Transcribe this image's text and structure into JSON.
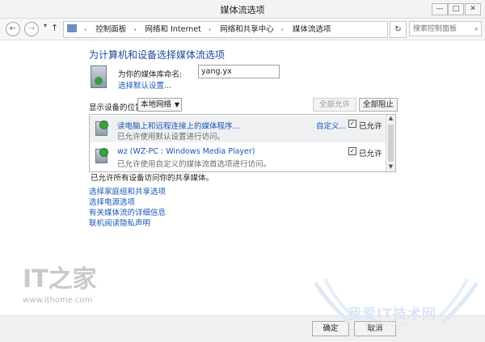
{
  "window": {
    "title": "媒体流选项",
    "buttons": {
      "minimize": "—",
      "maximize": "□",
      "close": "✕"
    }
  },
  "address": {
    "back": "←",
    "forward": "→",
    "up": "↑",
    "crumbs": [
      "控制面板",
      "网络和 Internet",
      "网络和共享中心",
      "媒体流选项"
    ],
    "separator": "›",
    "search_placeholder": "搜索控制面板"
  },
  "main": {
    "heading": "为计算机和设备选择媒体流选项",
    "library_label": "为你的媒体库命名:",
    "library_value": "yang.yx",
    "default_link": "选择默认设置...",
    "show_devices_label": "显示设备的位置:",
    "location_value": "本地网络",
    "allow_all": "全部允许",
    "block_all": "全部阻止",
    "devices": [
      {
        "title": "读电脑上和远程连接上的媒体程序...",
        "subtitle": "已允许使用默认设置进行访问。",
        "custom": "自定义...",
        "checked": "✓",
        "allowed": "已允许"
      },
      {
        "title": "wz (WZ-PC : Windows Media Player)",
        "subtitle": "已允许使用自定义的媒体流首选项进行访问。",
        "checked": "✓",
        "allowed": "已允许"
      }
    ],
    "summary": "已允许所有设备访问你的共享媒体。",
    "links": [
      "选择家庭组和共享选项",
      "选择电源选项",
      "有关媒体流的详细信息",
      "联机阅读隐私声明"
    ]
  },
  "watermark": {
    "brand": "IT之家",
    "url": "www.ithome.com"
  },
  "logo2": {
    "text": "我爱IT技术网",
    "url": "www.52ij.com"
  },
  "footer": {
    "ok": "确定",
    "cancel": "取消"
  }
}
